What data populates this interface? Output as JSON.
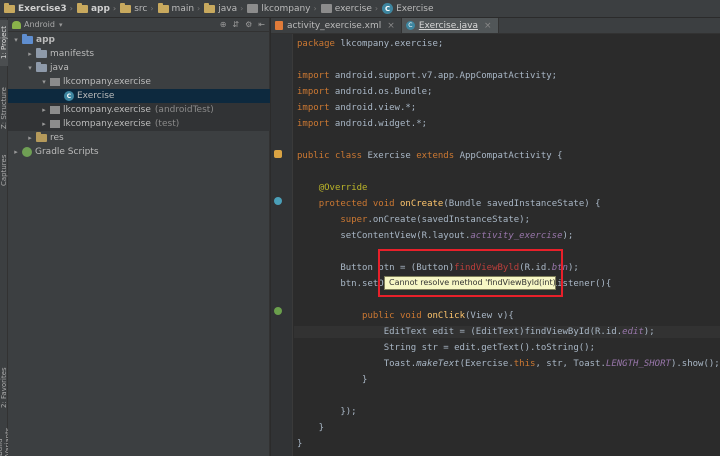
{
  "breadcrumb": [
    {
      "label": "Exercise3",
      "icon": "project-icon",
      "bold": true
    },
    {
      "label": "app",
      "icon": "folder-icon",
      "bold": true
    },
    {
      "label": "src",
      "icon": "folder-icon",
      "bold": false
    },
    {
      "label": "main",
      "icon": "folder-icon",
      "bold": false
    },
    {
      "label": "java",
      "icon": "folder-icon",
      "bold": false
    },
    {
      "label": "lkcompany",
      "icon": "package-icon",
      "bold": false
    },
    {
      "label": "exercise",
      "icon": "package-icon",
      "bold": false
    },
    {
      "label": "Exercise",
      "icon": "class-icon",
      "bold": false
    }
  ],
  "tool_strip": {
    "project_tab": "1: Project",
    "structure_tab": "Z: Structure",
    "captures_tab": "Captures",
    "favorites_tab": "2: Favorites",
    "variants_tab": "Build Variants"
  },
  "project_panel": {
    "view_selector": "Android",
    "tree": [
      {
        "label": "app",
        "indent": 0,
        "expanded": true,
        "icon": "folder-icon",
        "bold": true
      },
      {
        "label": "manifests",
        "indent": 1,
        "expanded": false,
        "icon": "folder-icon"
      },
      {
        "label": "java",
        "indent": 1,
        "expanded": true,
        "icon": "folder-icon"
      },
      {
        "label": "lkcompany.exercise",
        "indent": 2,
        "expanded": true,
        "icon": "package-icon"
      },
      {
        "label": "Exercise",
        "indent": 3,
        "expanded": null,
        "icon": "class-icon",
        "selected": true
      },
      {
        "label": "lkcompany.exercise",
        "suffix": "(androidTest)",
        "indent": 2,
        "expanded": false,
        "icon": "package-icon",
        "test": true
      },
      {
        "label": "lkcompany.exercise",
        "suffix": "(test)",
        "indent": 2,
        "expanded": false,
        "icon": "package-icon",
        "test": true
      },
      {
        "label": "res",
        "indent": 1,
        "expanded": false,
        "icon": "folder-icon"
      },
      {
        "label": "Gradle Scripts",
        "indent": 0,
        "expanded": false,
        "icon": "gradle-icon"
      }
    ]
  },
  "editor_tabs": [
    {
      "label": "activity_exercise.xml",
      "active": false
    },
    {
      "label": "Exercise.java",
      "active": true
    }
  ],
  "error_tooltip": "Cannot resolve method 'findViewByld(int)'",
  "code_lines": [
    "package lkcompany.exercise;",
    "",
    "import android.support.v7.app.AppCompatActivity;",
    "import android.os.Bundle;",
    "import android.view.*;",
    "import android.widget.*;",
    "",
    "public class Exercise extends AppCompatActivity {",
    "",
    "    @Override",
    "    protected void onCreate(Bundle savedInstanceState) {",
    "        super.onCreate(savedInstanceState);",
    "        setContentView(R.layout.activity_exercise);",
    "",
    "        Button btn = (Button)findViewByld(R.id.btn);",
    "        btn.setOnClickListener(new View.OnClickListener(){",
    "",
    "            public void onClick(View v){",
    "                EditText edit = (EditText)findViewById(R.id.edit);",
    "                String str = edit.getText().toString();",
    "                Toast.makeText(Exercise.this, str, Toast.LENGTH_SHORT).show();",
    "            }",
    "",
    "        });",
    "    }",
    "}"
  ],
  "colors": {
    "keyword": "#cc7832",
    "annotation": "#bbb529",
    "method": "#ffc66d",
    "field": "#9876aa",
    "error": "#bc3f3c",
    "error_box": "#e8202a",
    "selection": "#0d293e"
  }
}
